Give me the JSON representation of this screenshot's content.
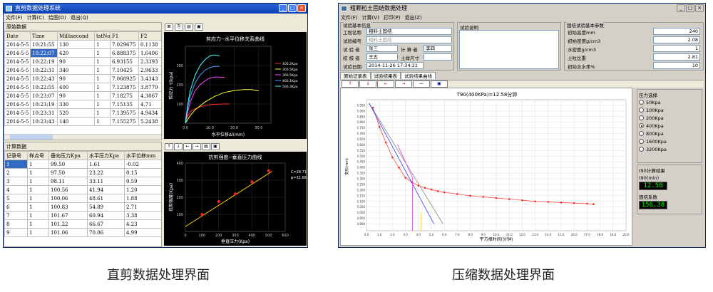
{
  "left": {
    "title": "直剪数据处理系统",
    "menu": [
      "文件(F)",
      "计算(C)",
      "绘图(D)",
      "退出(Q)"
    ],
    "raw_group": "原始数据",
    "raw_headers": [
      "Date",
      "Time",
      "Millisecond",
      "tstNo",
      "F1",
      "F2"
    ],
    "raw_rows": [
      [
        "2014-5-5",
        "10:21:55",
        "130",
        "1",
        "7.029675",
        "0.1138"
      ],
      [
        "2014-5-5",
        "10:22:07",
        "420",
        "1",
        "6.888375",
        "1.6406"
      ],
      [
        "2014-5-5",
        "10:22:19",
        "90",
        "1",
        "6.93155",
        "2.3393"
      ],
      [
        "2014-5-5",
        "10:22:31",
        "340",
        "1",
        "7.10425",
        "2.9633"
      ],
      [
        "2014-5-5",
        "10:22:43",
        "90",
        "1",
        "7.068925",
        "3.4343"
      ],
      [
        "2014-5-5",
        "10:22:55",
        "400",
        "1",
        "7.123875",
        "3.8779"
      ],
      [
        "2014-5-5",
        "10:23:07",
        "90",
        "1",
        "7.18275",
        "4.3067"
      ],
      [
        "2014-5-5",
        "10:23:19",
        "330",
        "1",
        "7.15135",
        "4.71"
      ],
      [
        "2014-5-5",
        "10:23:31",
        "520",
        "1",
        "7.139575",
        "4.9434"
      ],
      [
        "2014-5-5",
        "10:23:43",
        "140",
        "1",
        "7.155275",
        "5.2438"
      ]
    ],
    "calc_group": "计算数据",
    "calc_headers": [
      "记录号",
      "样点号",
      "垂向压力Kpa",
      "水平压力Kpa",
      "水平位移mm"
    ],
    "calc_rows": [
      [
        "1",
        "1",
        "99.50",
        "1.61",
        "-0.02"
      ],
      [
        "2",
        "1",
        "97.50",
        "23.22",
        "0.15"
      ],
      [
        "3",
        "1",
        "98.11",
        "33.11",
        "0.59"
      ],
      [
        "4",
        "1",
        "100.56",
        "41.94",
        "1.20"
      ],
      [
        "5",
        "1",
        "100.06",
        "48.61",
        "1.88"
      ],
      [
        "6",
        "1",
        "100.83",
        "54.89",
        "2.71"
      ],
      [
        "7",
        "1",
        "101.67",
        "60.94",
        "3.38"
      ],
      [
        "8",
        "1",
        "101.22",
        "66.67",
        "4.23"
      ],
      [
        "9",
        "1",
        "101.06",
        "70.06",
        "4.99"
      ]
    ],
    "caption": "直剪数据处理界面"
  },
  "right": {
    "title": "粗颗粒土固结数据处理",
    "menu": [
      "文件(F)",
      "计算(V)",
      "打印(P)",
      "退出(Z)"
    ],
    "basic_group": "试验基本信息",
    "basic_fields": [
      {
        "label": "工程名称",
        "value": "粗料土固结"
      },
      {
        "label": "试验编号",
        "value": "粗料土固结"
      },
      {
        "label": "试 验 者",
        "value": "张三"
      },
      {
        "label": "校 核 者",
        "value": "王五"
      },
      {
        "label": "试验日期",
        "value": "2014-11-26 17:34:21"
      }
    ],
    "calc_label": "计 算 者",
    "calc_value": "李四",
    "size_label": "土样尺寸",
    "desc_label": "试验说明",
    "consol_group": "固结试验基本参数",
    "params": [
      {
        "label": "初始高度mm",
        "value": "240"
      },
      {
        "label": "初始密度g/cm3",
        "value": "2.08"
      },
      {
        "label": "水密度g/cm3",
        "value": "1"
      },
      {
        "label": "土粒比重",
        "value": "2.81"
      },
      {
        "label": "初始含水率%",
        "value": "10"
      }
    ],
    "tabs": [
      "原始记录表",
      "试验结果表",
      "试验结果曲线"
    ],
    "toolbar": [
      "↑",
      "↓",
      "←",
      "→",
      "—",
      "💾"
    ],
    "pressure_group": "压力选择",
    "pressures": [
      "50Kpa",
      "100Kpa",
      "200Kpa",
      "400Kpa",
      "800Kpa",
      "1600Kpa",
      "3200Kpa"
    ],
    "selected_pressure": "400Kpa",
    "t90_label": "t90计算结果",
    "t90_unit": "t90(min)",
    "t90_value": "12.58",
    "coef_label": "固结系数",
    "coef_value": "156.38",
    "caption": "压缩数据处理界面"
  },
  "chart_data": [
    {
      "type": "line",
      "title": "剪应力--水平位移关系曲线",
      "xlabel": "水平位移Δl(mm)",
      "ylabel": "剪应力 τ(kpa)",
      "xlim": [
        0,
        35
      ],
      "ylim": [
        0,
        400
      ],
      "xticks": [
        "0.0",
        "10.0",
        "20.0",
        "30.0"
      ],
      "yticks": [
        "100",
        "200",
        "300"
      ],
      "series": [
        {
          "name": "100.2Kpa",
          "color": "#ff3030",
          "x": [
            0,
            1,
            2,
            4,
            6,
            8,
            10,
            12,
            15,
            18
          ],
          "y": [
            0,
            40,
            60,
            75,
            85,
            92,
            96,
            98,
            100,
            100
          ]
        },
        {
          "name": "300.5Kpa",
          "color": "#ffff30",
          "x": [
            0,
            2,
            4,
            8,
            12,
            16,
            20,
            24,
            27,
            30
          ],
          "y": [
            0,
            40,
            70,
            110,
            140,
            160,
            170,
            175,
            175,
            168
          ]
        },
        {
          "name": "300.5Kpa",
          "color": "#ff40ff",
          "x": [
            0,
            1,
            2,
            4,
            6,
            8,
            10,
            12,
            14,
            16
          ],
          "y": [
            0,
            60,
            110,
            170,
            200,
            220,
            235,
            240,
            240,
            238
          ]
        },
        {
          "name": "400.1Kpa",
          "color": "#40a0ff",
          "x": [
            0,
            1,
            2,
            4,
            6,
            8,
            10,
            12,
            14
          ],
          "y": [
            0,
            80,
            140,
            210,
            250,
            275,
            290,
            295,
            296
          ]
        },
        {
          "name": "500.3Kpa",
          "color": "#40ffff",
          "x": [
            0,
            1,
            2,
            4,
            6,
            8,
            10,
            12,
            14
          ],
          "y": [
            0,
            100,
            170,
            250,
            300,
            330,
            350,
            355,
            350
          ]
        }
      ]
    },
    {
      "type": "scatter",
      "title": "抗剪强度--垂直压力曲线",
      "xlabel": "垂直压力(Kpa)",
      "ylabel": "抗剪强度(Kpa)",
      "xlim": [
        0,
        600
      ],
      "ylim": [
        0,
        400
      ],
      "xticks": [
        "0",
        "100",
        "200",
        "300",
        "400",
        "500",
        "600"
      ],
      "yticks": [
        "100",
        "200",
        "300",
        "400"
      ],
      "annotation": [
        "C=28.71",
        "φ=31.66"
      ],
      "points_x": [
        100,
        200,
        300,
        400,
        500
      ],
      "points_y": [
        100,
        175,
        220,
        290,
        355
      ]
    },
    {
      "type": "line",
      "title": "T90(400KPa)=12.58分钟",
      "xlabel": "平方根时间(分钟)",
      "ylabel": "变形(mm)",
      "xlim": [
        0,
        20
      ],
      "ylim": [
        4.84,
        6.0
      ],
      "xticks": [
        "0.0",
        "1.0",
        "2.0",
        "3.0",
        "4.0",
        "5.0",
        "6.0",
        "7.0",
        "8.0",
        "9.0",
        "10.0",
        "11.0",
        "12.0",
        "13.0",
        "14.0",
        "15.0",
        "16.0",
        "17.0",
        "18.0",
        "19.0",
        "20.0"
      ],
      "yticks": [
        "5.950",
        "5.900",
        "5.850",
        "5.800",
        "5.750",
        "5.700",
        "5.650",
        "5.600",
        "5.550",
        "5.500",
        "5.450",
        "5.400",
        "5.350",
        "5.300",
        "5.250",
        "5.200",
        "5.150",
        "5.100",
        "5.050",
        "5.000",
        "4.950",
        "4.900"
      ],
      "points_x": [
        0.5,
        1,
        1.5,
        2,
        2.5,
        3,
        3.5,
        4,
        4.5,
        5,
        5.5,
        6,
        7,
        8,
        9,
        10,
        11,
        12,
        13,
        14,
        15,
        16,
        17,
        17.5
      ],
      "points_y": [
        5.93,
        5.76,
        5.62,
        5.49,
        5.4,
        5.31,
        5.27,
        5.24,
        5.22,
        5.205,
        5.19,
        5.18,
        5.165,
        5.15,
        5.14,
        5.13,
        5.12,
        5.11,
        5.1,
        5.095,
        5.09,
        5.085,
        5.08,
        5.075
      ]
    }
  ]
}
